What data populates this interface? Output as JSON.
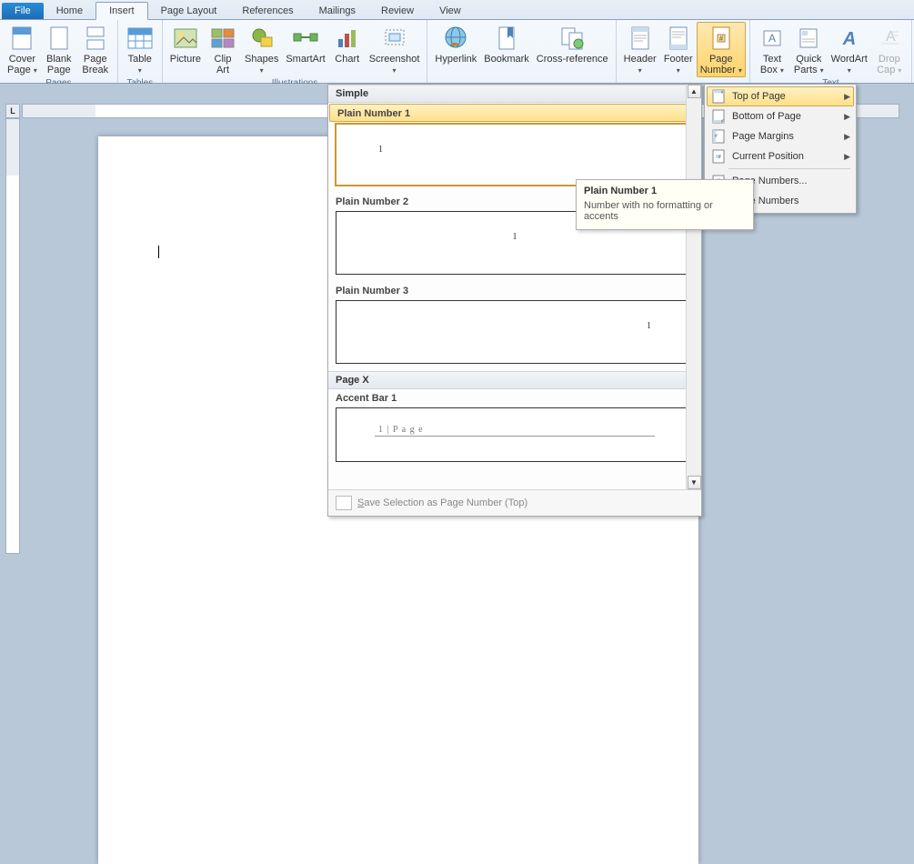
{
  "tabs": {
    "file": "File",
    "home": "Home",
    "insert": "Insert",
    "pageLayout": "Page Layout",
    "references": "References",
    "mailings": "Mailings",
    "review": "Review",
    "view": "View"
  },
  "ribbon": {
    "pages": {
      "label": "Pages",
      "cover": "Cover\nPage ▾",
      "blank": "Blank\nPage",
      "break": "Page\nBreak"
    },
    "tables": {
      "label": "Tables",
      "table": "Table\n▾"
    },
    "illustrations": {
      "label": "Illustrations",
      "picture": "Picture",
      "clipart": "Clip\nArt",
      "shapes": "Shapes\n▾",
      "smartart": "SmartArt",
      "chart": "Chart",
      "screenshot": "Screenshot\n▾"
    },
    "links": {
      "hyperlink": "Hyperlink",
      "bookmark": "Bookmark",
      "crossref": "Cross-reference"
    },
    "headerfooter": {
      "header": "Header\n▾",
      "footer": "Footer\n▾",
      "pagenumber": "Page\nNumber ▾"
    },
    "text": {
      "label": "Text",
      "textbox": "Text\nBox ▾",
      "quickparts": "Quick\nParts ▾",
      "wordart": "WordArt\n▾",
      "dropcap": "Drop\nCap ▾"
    }
  },
  "pageNumberMenu": {
    "top": "Top of Page",
    "bottom": "Bottom of Page",
    "margins": "Page Margins",
    "current": "Current Position",
    "format": "Page Numbers...",
    "remove": "Page Numbers"
  },
  "gallery": {
    "group1": "Simple",
    "items": [
      {
        "label": "Plain Number 1",
        "pos": "left",
        "num": "1"
      },
      {
        "label": "Plain Number 2",
        "pos": "center",
        "num": "1"
      },
      {
        "label": "Plain Number 3",
        "pos": "right",
        "num": "1"
      }
    ],
    "group2": "Page X",
    "accent": {
      "label": "Accent Bar 1",
      "text": "1 | P a g e"
    },
    "cmd": "Save Selection as Page Number (Top)"
  },
  "tooltip": {
    "title": "Plain Number 1",
    "body": "Number with no formatting or accents"
  },
  "rulerCorner": "L"
}
